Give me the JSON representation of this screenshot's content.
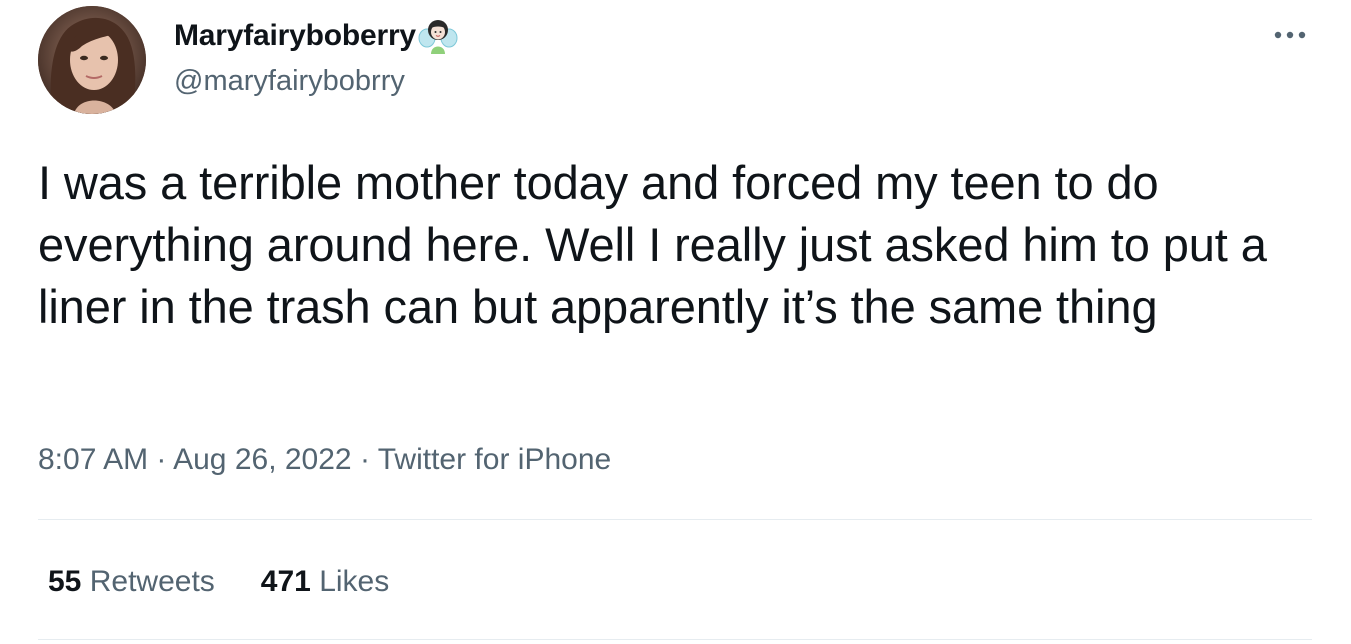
{
  "author": {
    "display_name": "Maryfairyboberry",
    "name_emoji": "fairy-icon",
    "handle": "@maryfairybobrry"
  },
  "menu": {
    "more_icon": "more-horizontal-icon"
  },
  "tweet": {
    "text": "I was a terrible mother today and forced my teen to do everything around here. Well I really just asked him to put a liner in the trash can but apparently it’s the same thing"
  },
  "meta": {
    "time": "8:07 AM",
    "separator": "·",
    "date": "Aug 26, 2022",
    "source": "Twitter for iPhone"
  },
  "stats": {
    "retweets_count": "55",
    "retweets_label": "Retweets",
    "likes_count": "471",
    "likes_label": "Likes"
  },
  "colors": {
    "text_primary": "#0f1419",
    "text_secondary": "#536471",
    "divider": "#e6ecf0"
  }
}
